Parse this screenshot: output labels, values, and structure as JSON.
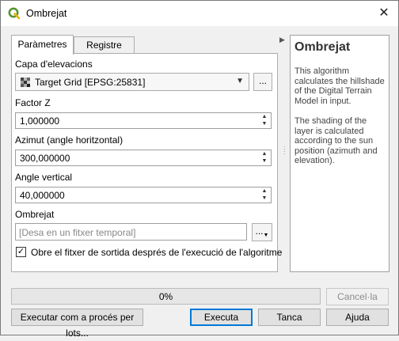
{
  "window": {
    "title": "Ombrejat",
    "close_icon": "close-icon",
    "app_icon": "qgis-logo-icon"
  },
  "tabs": [
    {
      "label": "Paràmetres"
    },
    {
      "label": "Registre"
    }
  ],
  "params": {
    "elevation_label": "Capa d'elevacions",
    "elevation_value": "Target Grid [EPSG:25831]",
    "elevation_more": "...",
    "z_label": "Factor Z",
    "z_value": "1,000000",
    "azimuth_label": "Azimut (angle horitzontal)",
    "azimuth_value": "300,000000",
    "vertical_label": "Angle vertical",
    "vertical_value": "40,000000",
    "output_label": "Ombrejat",
    "output_placeholder": "[Desa en un fitxer temporal]",
    "output_more": "...",
    "open_checkbox_label": "Obre el fitxer de sortida després de l'execució de l'algoritme",
    "open_checked": true
  },
  "help": {
    "title": "Ombrejat",
    "para1": "This algorithm calculates the hillshade of the Digital Terrain Model in input.",
    "para2": "The shading of the layer is calculated according to the sun position (azimuth and elevation)."
  },
  "progress": {
    "text": "0%",
    "value": 0
  },
  "buttons": {
    "cancel": "Cancel·la",
    "batch": "Executar com a procés per lots...",
    "run": "Executa",
    "close": "Tanca",
    "help": "Ajuda"
  },
  "colors": {
    "accent": "#0078d7",
    "qgis_green": "#589632",
    "qgis_yellow": "#ee7913"
  }
}
